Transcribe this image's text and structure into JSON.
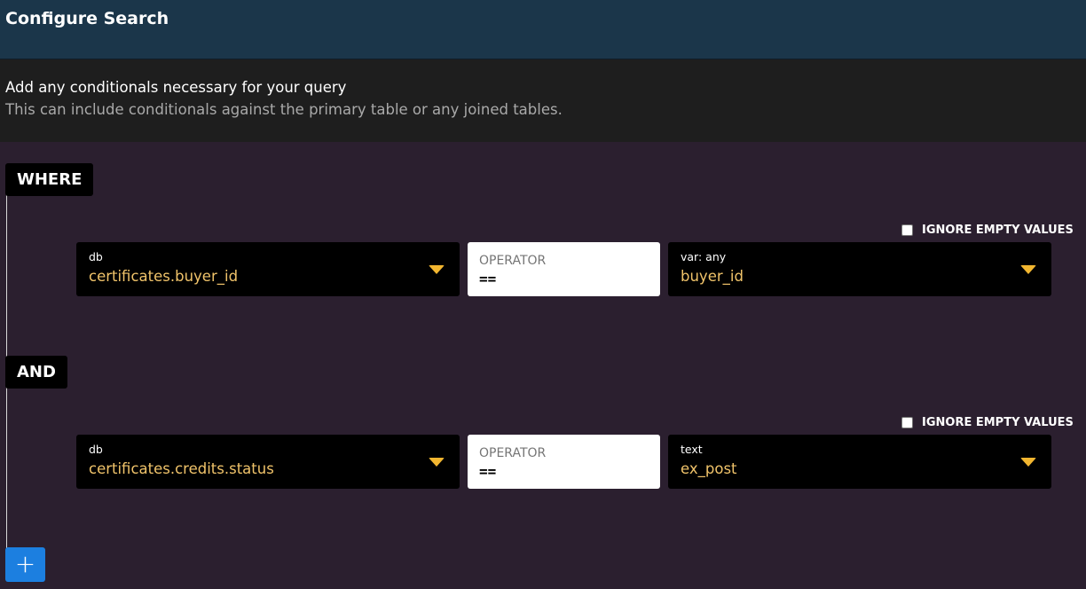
{
  "header": {
    "title": "Configure Search"
  },
  "info": {
    "title": "Add any conditionals necessary for your query",
    "subtitle": "This can include conditionals against the primary table or any joined tables."
  },
  "conditions": [
    {
      "logic": "WHERE",
      "ignore_label": "IGNORE EMPTY VALUES",
      "left_label": "db",
      "left_value": "certificates.buyer_id",
      "operator_label": "OPERATOR",
      "operator_value": "==",
      "right_label": "var: any",
      "right_value": "buyer_id"
    },
    {
      "logic": "AND",
      "ignore_label": "IGNORE EMPTY VALUES",
      "left_label": "db",
      "left_value": "certificates.credits.status",
      "operator_label": "OPERATOR",
      "operator_value": "==",
      "right_label": "text",
      "right_value": "ex_post"
    }
  ],
  "add_button": {
    "label": "+"
  },
  "colors": {
    "header_bg": "#1b364a",
    "info_bg": "#1e1e1e",
    "main_bg": "#2b1f2f",
    "value_text": "#f0c36a",
    "caret": "#f2b630",
    "add_button": "#1c7fe0"
  },
  "icons": {
    "dropdown": "caret-down-icon",
    "add": "plus-icon"
  }
}
